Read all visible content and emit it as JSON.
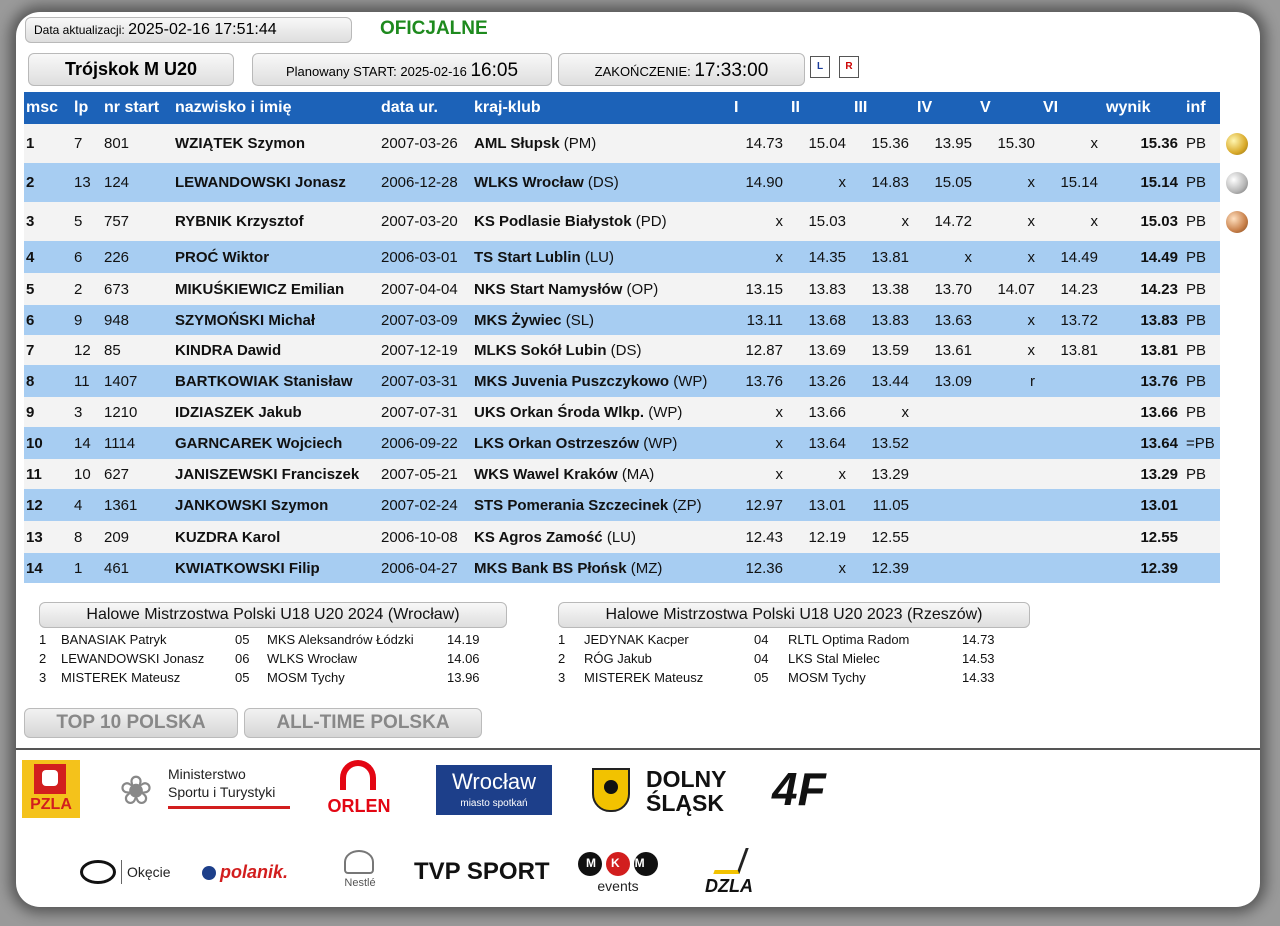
{
  "header": {
    "update_label": "Data aktualizacji:",
    "update_value": "2025-02-16 17:51:44",
    "status": "OFICJALNE",
    "event": "Trójskok M U20",
    "start_label": "Planowany START: 2025-02-16",
    "start_time": "16:05",
    "end_label": "ZAKOŃCZENIE:",
    "end_time": "17:33:00",
    "pdf_icons": [
      "pdf-list-icon",
      "pdf-results-icon"
    ]
  },
  "columns": [
    "msc",
    "lp",
    "nr start",
    "nazwisko i imię",
    "data ur.",
    "kraj-klub",
    "I",
    "II",
    "III",
    "IV",
    "V",
    "VI",
    "wynik",
    "inf"
  ],
  "rows": [
    {
      "msc": "1",
      "lp": "7",
      "nr": "801",
      "name": "WZIĄTEK Szymon",
      "born": "2007-03-26",
      "club": "AML Słupsk",
      "region": "(PM)",
      "a": [
        "14.73",
        "15.04",
        "15.36",
        "13.95",
        "15.30",
        "x"
      ],
      "result": "15.36",
      "inf": "PB",
      "medal": "gold"
    },
    {
      "msc": "2",
      "lp": "13",
      "nr": "124",
      "name": "LEWANDOWSKI Jonasz",
      "born": "2006-12-28",
      "club": "WLKS Wrocław",
      "region": "(DS)",
      "a": [
        "14.90",
        "x",
        "14.83",
        "15.05",
        "x",
        "15.14"
      ],
      "result": "15.14",
      "inf": "PB",
      "medal": "silver"
    },
    {
      "msc": "3",
      "lp": "5",
      "nr": "757",
      "name": "RYBNIK Krzysztof",
      "born": "2007-03-20",
      "club": "KS Podlasie Białystok",
      "region": "(PD)",
      "a": [
        "x",
        "15.03",
        "x",
        "14.72",
        "x",
        "x"
      ],
      "result": "15.03",
      "inf": "PB",
      "medal": "bronze"
    },
    {
      "msc": "4",
      "lp": "6",
      "nr": "226",
      "name": "PROĆ Wiktor",
      "born": "2006-03-01",
      "club": "TS Start Lublin",
      "region": "(LU)",
      "a": [
        "x",
        "14.35",
        "13.81",
        "x",
        "x",
        "14.49"
      ],
      "result": "14.49",
      "inf": "PB",
      "medal": ""
    },
    {
      "msc": "5",
      "lp": "2",
      "nr": "673",
      "name": "MIKUŚKIEWICZ Emilian",
      "born": "2007-04-04",
      "club": "NKS Start Namysłów",
      "region": "(OP)",
      "a": [
        "13.15",
        "13.83",
        "13.38",
        "13.70",
        "14.07",
        "14.23"
      ],
      "result": "14.23",
      "inf": "PB",
      "medal": ""
    },
    {
      "msc": "6",
      "lp": "9",
      "nr": "948",
      "name": "SZYMOŃSKI Michał",
      "born": "2007-03-09",
      "club": "MKS Żywiec",
      "region": "(SL)",
      "a": [
        "13.11",
        "13.68",
        "13.83",
        "13.63",
        "x",
        "13.72"
      ],
      "result": "13.83",
      "inf": "PB",
      "medal": ""
    },
    {
      "msc": "7",
      "lp": "12",
      "nr": "85",
      "name": "KINDRA Dawid",
      "born": "2007-12-19",
      "club": "MLKS Sokół Lubin",
      "region": "(DS)",
      "a": [
        "12.87",
        "13.69",
        "13.59",
        "13.61",
        "x",
        "13.81"
      ],
      "result": "13.81",
      "inf": "PB",
      "medal": ""
    },
    {
      "msc": "8",
      "lp": "11",
      "nr": "1407",
      "name": "BARTKOWIAK Stanisław",
      "born": "2007-03-31",
      "club": "MKS Juvenia Puszczykowo",
      "region": "(WP)",
      "a": [
        "13.76",
        "13.26",
        "13.44",
        "13.09",
        "r",
        ""
      ],
      "result": "13.76",
      "inf": "PB",
      "medal": ""
    },
    {
      "msc": "9",
      "lp": "3",
      "nr": "1210",
      "name": "IDZIASZEK Jakub",
      "born": "2007-07-31",
      "club": "UKS Orkan Środa Wlkp.",
      "region": "(WP)",
      "a": [
        "x",
        "13.66",
        "x",
        "",
        "",
        ""
      ],
      "result": "13.66",
      "inf": "PB",
      "medal": ""
    },
    {
      "msc": "10",
      "lp": "14",
      "nr": "1114",
      "name": "GARNCAREK Wojciech",
      "born": "2006-09-22",
      "club": "LKS Orkan Ostrzeszów",
      "region": "(WP)",
      "a": [
        "x",
        "13.64",
        "13.52",
        "",
        "",
        ""
      ],
      "result": "13.64",
      "inf": "=PB",
      "medal": ""
    },
    {
      "msc": "11",
      "lp": "10",
      "nr": "627",
      "name": "JANISZEWSKI Franciszek",
      "born": "2007-05-21",
      "club": "WKS Wawel Kraków",
      "region": "(MA)",
      "a": [
        "x",
        "x",
        "13.29",
        "",
        "",
        ""
      ],
      "result": "13.29",
      "inf": "PB",
      "medal": ""
    },
    {
      "msc": "12",
      "lp": "4",
      "nr": "1361",
      "name": "JANKOWSKI Szymon",
      "born": "2007-02-24",
      "club": "STS Pomerania Szczecinek",
      "region": "(ZP)",
      "a": [
        "12.97",
        "13.01",
        "11.05",
        "",
        "",
        ""
      ],
      "result": "13.01",
      "inf": "",
      "medal": ""
    },
    {
      "msc": "13",
      "lp": "8",
      "nr": "209",
      "name": "KUZDRA Karol",
      "born": "2006-10-08",
      "club": "KS Agros Zamość",
      "region": "(LU)",
      "a": [
        "12.43",
        "12.19",
        "12.55",
        "",
        "",
        ""
      ],
      "result": "12.55",
      "inf": "",
      "medal": ""
    },
    {
      "msc": "14",
      "lp": "1",
      "nr": "461",
      "name": "KWIATKOWSKI Filip",
      "born": "2006-04-27",
      "club": "MKS Bank BS Płońsk",
      "region": "(MZ)",
      "a": [
        "12.36",
        "x",
        "12.39",
        "",
        "",
        ""
      ],
      "result": "12.39",
      "inf": "",
      "medal": ""
    }
  ],
  "history": [
    {
      "title": "Halowe Mistrzostwa Polski U18 U20 2024 (Wrocław)",
      "rows": [
        {
          "pos": "1",
          "name": "BANASIAK Patryk",
          "yr": "05",
          "club": "MKS Aleksandrów Łódzki",
          "res": "14.19"
        },
        {
          "pos": "2",
          "name": "LEWANDOWSKI Jonasz",
          "yr": "06",
          "club": "WLKS Wrocław",
          "res": "14.06"
        },
        {
          "pos": "3",
          "name": "MISTEREK Mateusz",
          "yr": "05",
          "club": "MOSM Tychy",
          "res": "13.96"
        }
      ]
    },
    {
      "title": "Halowe Mistrzostwa Polski U18 U20 2023 (Rzeszów)",
      "rows": [
        {
          "pos": "1",
          "name": "JEDYNAK Kacper",
          "yr": "04",
          "club": "RLTL Optima Radom",
          "res": "14.73"
        },
        {
          "pos": "2",
          "name": "RÓG Jakub",
          "yr": "04",
          "club": "LKS Stal Mielec",
          "res": "14.53"
        },
        {
          "pos": "3",
          "name": "MISTEREK Mateusz",
          "yr": "05",
          "club": "MOSM Tychy",
          "res": "14.33"
        }
      ]
    }
  ],
  "buttons": {
    "top10": "TOP 10 POLSKA",
    "alltime": "ALL-TIME POLSKA"
  },
  "sponsors": {
    "pzla": "PZLA",
    "ministry_line1": "Ministerstwo",
    "ministry_line2": "Sportu i Turystyki",
    "orlen": "ORLEN",
    "wroclaw": "Wrocław",
    "wroclaw_sub": "miasto spotkań",
    "dolny1": "DOLNY",
    "dolny2": "ŚLĄSK",
    "fourf": "4F",
    "okecie": "Okęcie",
    "polanik": "polanik.",
    "nestle": "Nestlé",
    "tvp": "TVP SPORT",
    "mkm": "MKM",
    "mkm_sub": "events",
    "dzla": "DZLA"
  },
  "colors": {
    "header_blue": "#1c62b8",
    "row_blue": "#a7cdf2",
    "row_grey": "#f3f3f3",
    "official_green": "#1e8a1e"
  }
}
